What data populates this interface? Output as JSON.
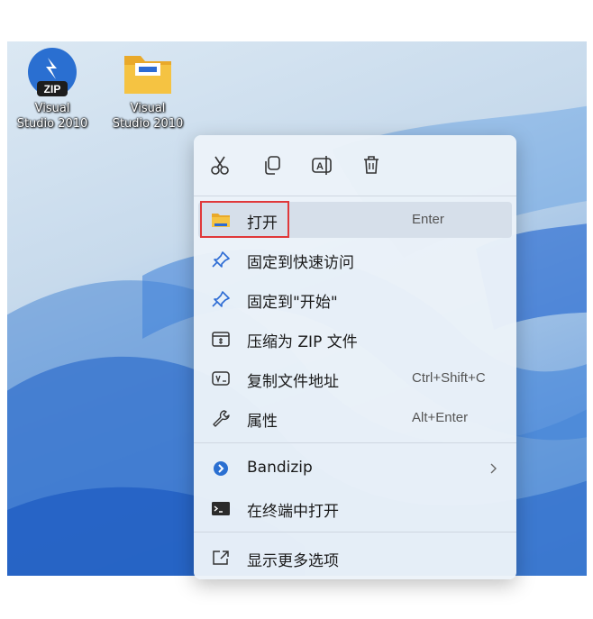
{
  "desktop": {
    "icons": [
      {
        "label_line1": "Visual",
        "label_line2": "Studio 2010",
        "icon": "bandizip-zip-icon"
      },
      {
        "label_line1": "Visual",
        "label_line2": "Studio 2010",
        "icon": "folder-icon"
      }
    ],
    "zip_badge": "ZIP"
  },
  "context_menu": {
    "toolbar": [
      {
        "name": "cut",
        "icon": "scissors-icon"
      },
      {
        "name": "copy",
        "icon": "copy-icon"
      },
      {
        "name": "rename",
        "icon": "rename-icon"
      },
      {
        "name": "delete",
        "icon": "trash-icon"
      }
    ],
    "items": [
      {
        "label": "打开",
        "shortcut": "Enter",
        "icon": "folder-icon"
      },
      {
        "label": "固定到快速访问",
        "shortcut": "",
        "icon": "pin-icon"
      },
      {
        "label": "固定到\"开始\"",
        "shortcut": "",
        "icon": "pin-icon"
      },
      {
        "label": "压缩为 ZIP 文件",
        "shortcut": "",
        "icon": "zip-file-icon"
      },
      {
        "label": "复制文件地址",
        "shortcut": "Ctrl+Shift+C",
        "icon": "copy-path-icon"
      },
      {
        "label": "属性",
        "shortcut": "Alt+Enter",
        "icon": "wrench-icon"
      },
      {
        "label": "Bandizip",
        "shortcut": "",
        "icon": "bandizip-icon",
        "submenu": true
      },
      {
        "label": "在终端中打开",
        "shortcut": "",
        "icon": "terminal-icon"
      },
      {
        "label": "显示更多选项",
        "shortcut": "",
        "icon": "show-more-icon"
      }
    ]
  },
  "colors": {
    "highlight_border": "#e0383a",
    "accent": "#2c6bd4",
    "folder_yellow": "#f5c342"
  }
}
